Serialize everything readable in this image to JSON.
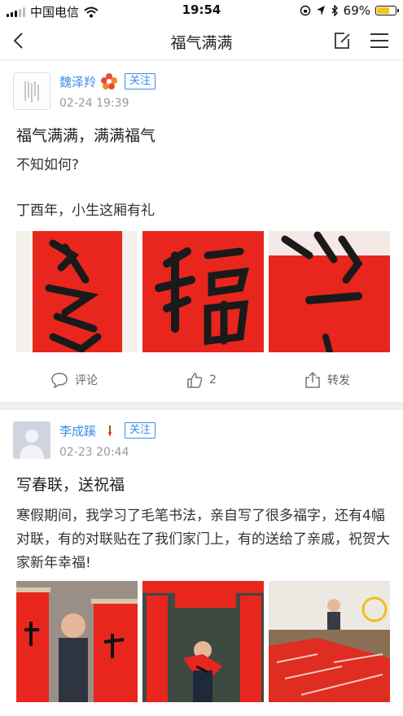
{
  "status_bar": {
    "carrier": "中国电信",
    "time": "19:54",
    "battery": "69%",
    "battery_level": 0.69
  },
  "nav": {
    "title": "福气满满",
    "icons": [
      "back-arrow-icon",
      "edit-icon",
      "menu-icon"
    ]
  },
  "posts": [
    {
      "user": "魏泽羚",
      "follow_label": "关注",
      "time": "02-24 19:39",
      "title": "福气满满，满满福气",
      "body_lines": [
        "不知如何?",
        "",
        "丁酉年，小生这厢有礼"
      ],
      "actions": {
        "comment": "评论",
        "like_count": "2",
        "share": "转发"
      }
    },
    {
      "user": "李成蹊",
      "follow_label": "关注",
      "time": "02-23 20:44",
      "title": "写春联，送祝福",
      "body": "寒假期间，我学习了毛笔书法，亲自写了很多福字，还有4幅对联，有的对联贴在了我们家门上，有的送给了亲戚，祝贺大家新年幸福!"
    }
  ],
  "colors": {
    "link_blue": "#3a8ee6",
    "paper_red": "#e8261d",
    "battery_yellow": "#f5c518"
  }
}
